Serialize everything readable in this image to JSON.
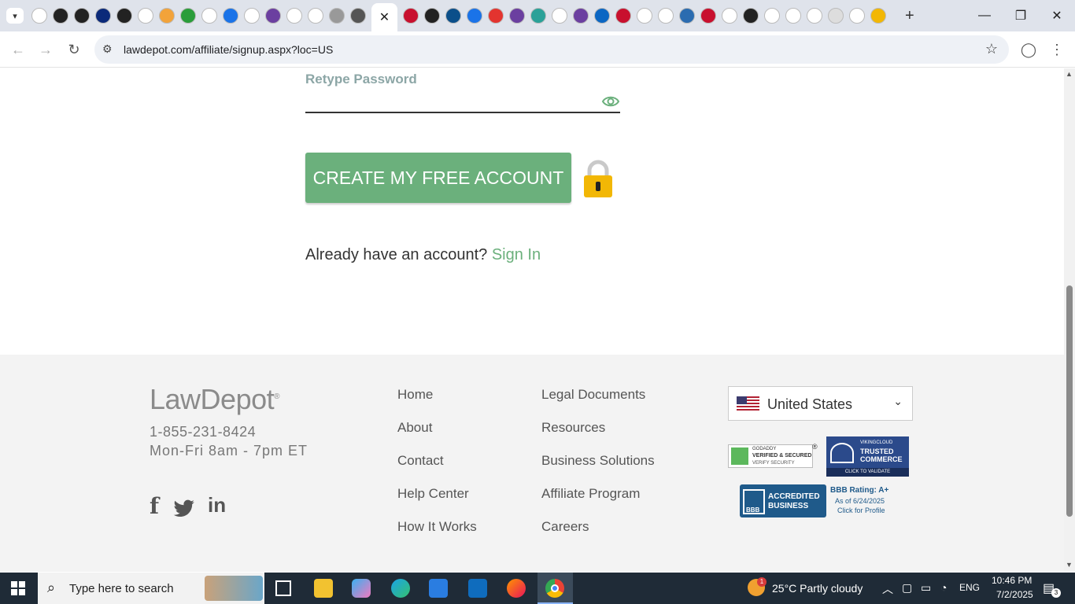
{
  "browser": {
    "url": "lawdepot.com/affiliate/signup.aspx?loc=US",
    "active_tab_close": "✕",
    "new_tab": "+"
  },
  "form": {
    "retype_password_label": "Retype Password",
    "create_button": "CREATE MY FREE ACCOUNT",
    "already_text": "Already have an account?",
    "sign_in": "Sign In"
  },
  "footer": {
    "logo_law": "Law",
    "logo_depot": "Depot",
    "phone": "1-855-231-8424",
    "hours": "Mon-Fri 8am - 7pm ET",
    "col1": [
      "Home",
      "About",
      "Contact",
      "Help Center",
      "How It Works"
    ],
    "col2": [
      "Legal Documents",
      "Resources",
      "Business Solutions",
      "Affiliate Program",
      "Careers"
    ],
    "country": "United States",
    "badges": {
      "godaddy_line1": "GODADDY",
      "godaddy_line2": "VERIFIED & SECURED",
      "godaddy_line3": "VERIFY SECURITY",
      "viking_line1": "VIKINGCLOUD",
      "viking_line2": "TRUSTED",
      "viking_line3": "COMMERCE",
      "viking_line4": "CLICK TO VALIDATE",
      "bbb_logo": "BBB",
      "bbb_line1": "ACCREDITED",
      "bbb_line2": "BUSINESS",
      "bbb_rating": "BBB Rating: A+",
      "bbb_date": "As of 6/24/2025",
      "bbb_click": "Click for Profile"
    }
  },
  "taskbar": {
    "search_placeholder": "Type here to search",
    "weather": "25°C  Partly cloudy",
    "weather_badge": "1",
    "lang": "ENG",
    "time": "10:46 PM",
    "date": "7/2/2025",
    "notifications": "3"
  },
  "colors": {
    "accent_green": "#6bb07c",
    "footer_bg": "#f3f3f3",
    "taskbar_bg": "#1f2b37"
  }
}
